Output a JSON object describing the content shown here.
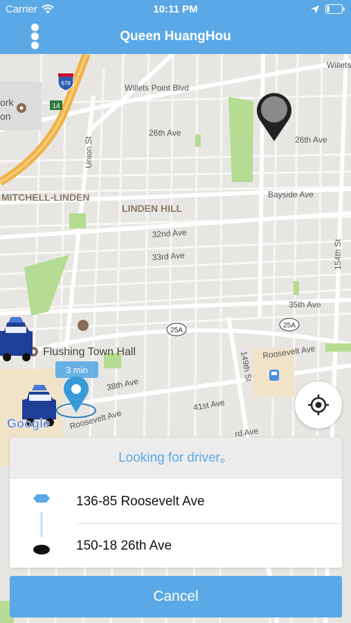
{
  "status_bar": {
    "carrier": "Carrier",
    "time": "10:11 PM"
  },
  "nav": {
    "title": "Queen HuangHou"
  },
  "map": {
    "streets": {
      "willets_point": "Willets Point Blvd",
      "willets_top": "Willets",
      "ave26": "26th Ave",
      "ave26_right": "26th Ave",
      "union": "Union St",
      "bayside": "Bayside Ave",
      "ave32": "32nd Ave",
      "ave33": "33rd Ave",
      "ave35": "35th Ave",
      "st154": "154th St",
      "st149": "149th St",
      "roosevelt_right": "Roosevelt Ave",
      "roosevelt_left": "Roosevelt Ave",
      "ave38": "38th Ave",
      "ave41": "41st Ave",
      "ave_lower": "rd Ave"
    },
    "neighborhoods": {
      "mitchell": "MITCHELL-LINDEN",
      "linden": "LINDEN HILL"
    },
    "poi": {
      "town_hall": "Flushing Town Hall",
      "park_top": "ork",
      "park_bottom": "on"
    },
    "route_shields": {
      "i678": "678",
      "r14": "14",
      "r25a_left": "25A",
      "r25a_right": "25A"
    },
    "eta": "3 min",
    "google": "Google"
  },
  "ride": {
    "status": "Looking for driver。",
    "pickup": "136-85 Roosevelt Ave",
    "dropoff": "150-18 26th Ave"
  },
  "actions": {
    "cancel": "Cancel"
  },
  "colors": {
    "brand": "#5aa9e6",
    "map_bg": "#e8e6e2",
    "park": "#b5dc93",
    "highway": "#f0b247"
  }
}
